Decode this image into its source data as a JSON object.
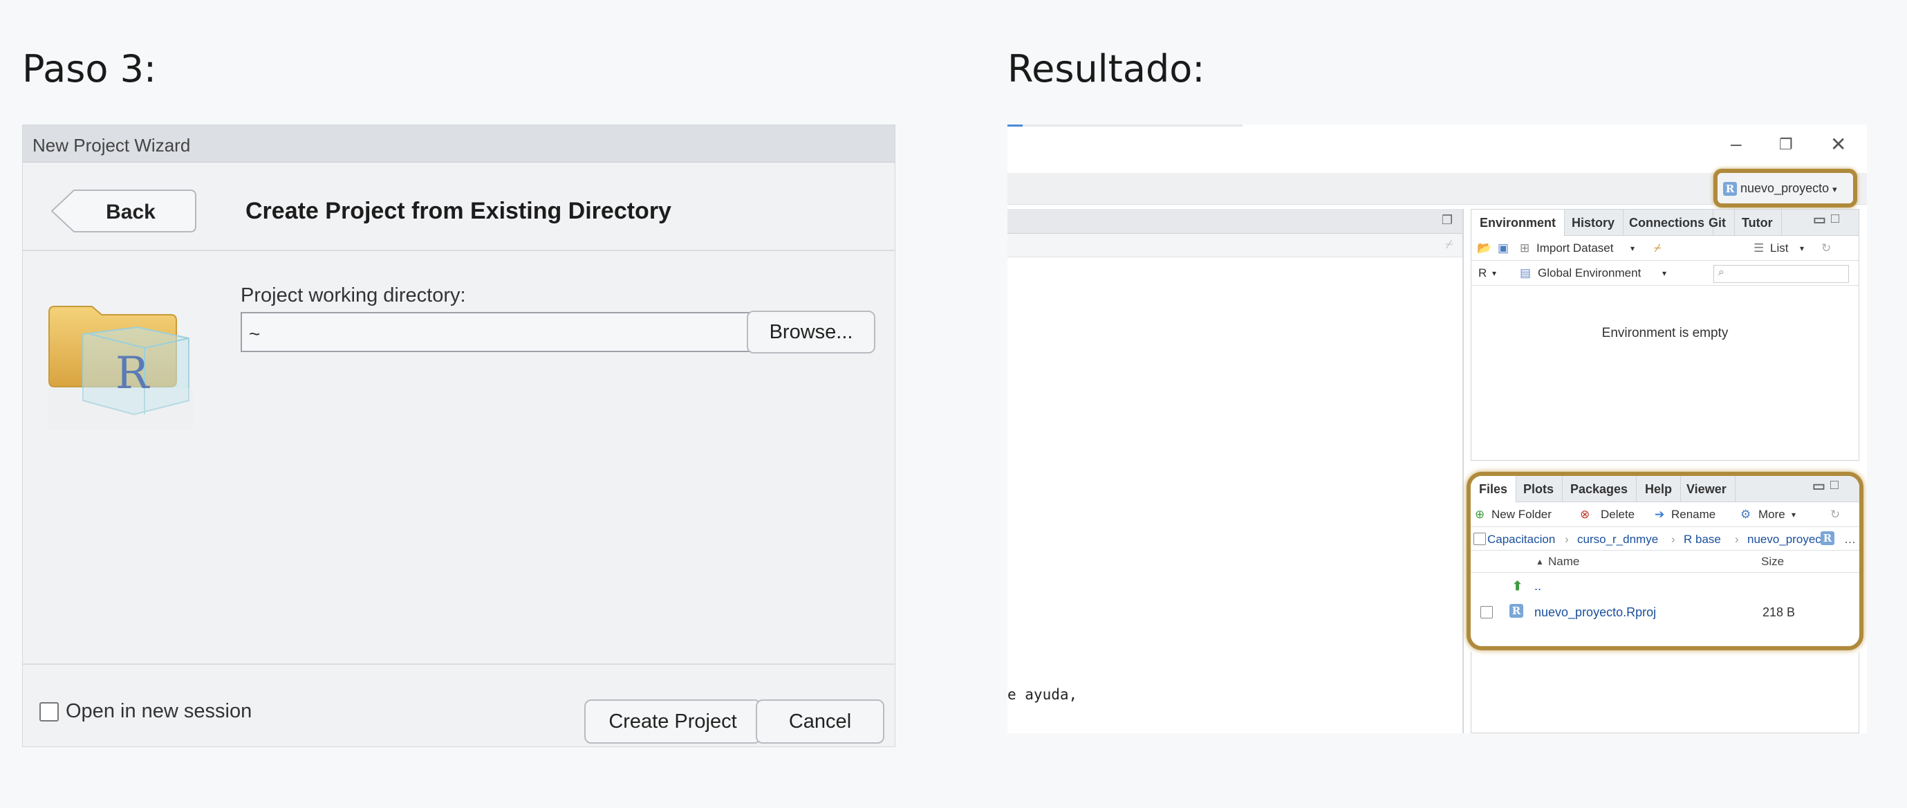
{
  "headings": {
    "left": "Paso 3:",
    "right": "Resultado:"
  },
  "wizard": {
    "title_bar": "New Project Wizard",
    "back_label": "Back",
    "title": "Create Project from Existing Directory",
    "dir_label": "Project working directory:",
    "dir_value": "~",
    "browse_label": "Browse...",
    "open_new_session_label": "Open in new session",
    "open_new_session_checked": false,
    "create_label": "Create Project",
    "cancel_label": "Cancel"
  },
  "rstudio": {
    "window_controls": {
      "minimize": "–",
      "restore": "❐",
      "close": "✕"
    },
    "project_menu": "nuevo_proyecto",
    "console_line": "e ayuda,",
    "env_pane": {
      "tabs": [
        "Environment",
        "History",
        "Connections",
        "Git",
        "Tutor"
      ],
      "import_dataset": "Import Dataset",
      "list_view": "List",
      "lang": "R",
      "scope": "Global Environment",
      "empty_message": "Environment is empty"
    },
    "files_pane": {
      "tabs": [
        "Files",
        "Plots",
        "Packages",
        "Help",
        "Viewer"
      ],
      "new_folder": "New Folder",
      "delete": "Delete",
      "rename": "Rename",
      "more": "More",
      "breadcrumb": [
        "Capacitacion",
        "curso_r_dnmye",
        "R base",
        "nuevo_proyec"
      ],
      "breadcrumb_more": "…",
      "col_name": "Name",
      "col_size": "Size",
      "up_label": "..",
      "rows": [
        {
          "name": "nuevo_proyecto.Rproj",
          "size": "218 B"
        }
      ]
    }
  },
  "colors": {
    "highlight": "#b08a3c",
    "link_blue": "#1a4f9c"
  }
}
